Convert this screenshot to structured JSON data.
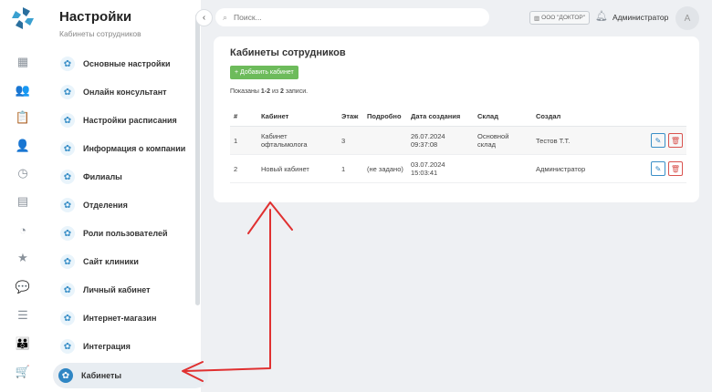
{
  "rail": {
    "icons": [
      "calendar-icon",
      "users-icon",
      "clipboard-icon",
      "user-icon",
      "clock-icon",
      "table-icon",
      "pie-chart-icon",
      "star-icon",
      "chat-icon",
      "list-icon",
      "group-icon",
      "cart-icon"
    ],
    "glyphs": [
      "▦",
      "👥",
      "📋",
      "👤",
      "◷",
      "▤",
      "◔",
      "★",
      "💬",
      "☰",
      "👪",
      "🛒"
    ]
  },
  "sidebar": {
    "title": "Настройки",
    "subtitle": "Кабинеты сотрудников",
    "items": [
      {
        "label": "Основные настройки"
      },
      {
        "label": "Онлайн консультант"
      },
      {
        "label": "Настройки расписания"
      },
      {
        "label": "Информация о компании"
      },
      {
        "label": "Филиалы"
      },
      {
        "label": "Отделения"
      },
      {
        "label": "Роли пользователей"
      },
      {
        "label": "Сайт клиники"
      },
      {
        "label": "Личный кабинет"
      },
      {
        "label": "Интернет-магазин"
      },
      {
        "label": "Интеграция"
      },
      {
        "label": "Кабинеты"
      }
    ]
  },
  "topbar": {
    "search_placeholder": "Поиск...",
    "org": "ООО \"ДОКТОР\"",
    "user": "Администратор",
    "avatar": "А"
  },
  "card": {
    "title": "Кабинеты сотрудников",
    "add_label": "+ Добавить кабинет",
    "shown_prefix": "Показаны ",
    "shown_range": "1-2",
    "shown_mid": " из ",
    "shown_total": "2",
    "shown_suffix": " записи."
  },
  "table": {
    "headers": [
      "#",
      "Кабинет",
      "Этаж",
      "Подробно",
      "Дата создания",
      "Склад",
      "Создал"
    ],
    "rows": [
      {
        "num": "1",
        "name": "Кабинет офтальмолога",
        "floor": "3",
        "details": "",
        "date": "26.07.2024 09:37:08",
        "stock": "Основной склад",
        "creator": "Тестов Т.Т."
      },
      {
        "num": "2",
        "name": "Новый кабинет",
        "floor": "1",
        "details": "(не задано)",
        "date": "03.07.2024 15:03:41",
        "stock": "",
        "creator": "Администратор"
      }
    ]
  },
  "colors": {
    "accent": "#2f86c4",
    "add_button": "#6dbb5b",
    "delete": "#d9534f",
    "annotation_arrow": "#e03030"
  }
}
